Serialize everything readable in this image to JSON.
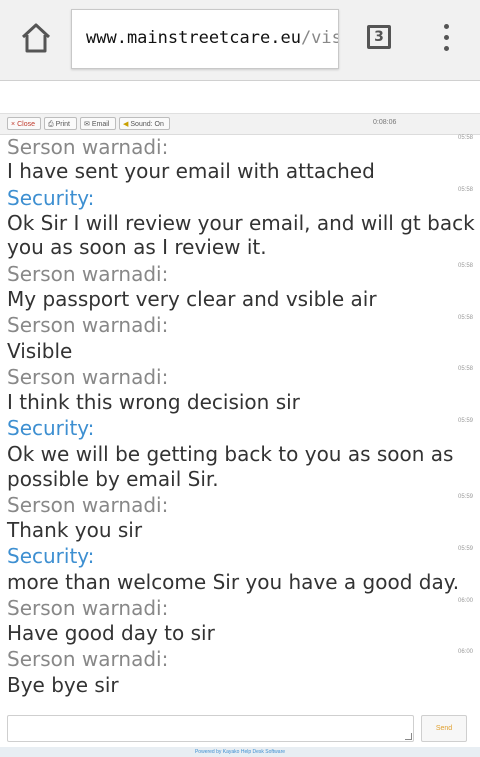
{
  "browser": {
    "url_host": "www.mainstreetcare.eu",
    "url_path": "/visi",
    "tab_count": "3"
  },
  "toolbar": {
    "close_label": "Close",
    "print_label": "Print",
    "email_label": "Email",
    "sound_label": "Sound: On",
    "timer": "0:08:06"
  },
  "chat": {
    "messages": [
      {
        "sender": "Serson warnadi:",
        "text": "I have sent your email with attached",
        "time": "05:58",
        "role": "visitor"
      },
      {
        "sender": "Security:",
        "text": "Ok Sir I will review your email, and will gt back to",
        "text2": "you as soon as I review it.",
        "time": "05:58",
        "role": "staff"
      },
      {
        "sender": "Serson warnadi:",
        "text": "My passport very clear and vsible air",
        "time": "05:58",
        "role": "visitor"
      },
      {
        "sender": "Serson warnadi:",
        "text": "Visible",
        "time": "05:58",
        "role": "visitor"
      },
      {
        "sender": "Serson warnadi:",
        "text": "I think this wrong decision sir",
        "time": "05:59",
        "role": "visitor"
      },
      {
        "sender": "Security:",
        "text": "Ok we will be getting back to you as soon as",
        "text2": "possible by email Sir.",
        "time": "05:59",
        "role": "staff"
      },
      {
        "sender": "Serson warnadi:",
        "text": "Thank you sir",
        "time": "05:59",
        "role": "visitor"
      },
      {
        "sender": "Security:",
        "text": "more than welcome Sir you have a good day.",
        "time": "06:00",
        "role": "staff"
      },
      {
        "sender": "Serson warnadi:",
        "text": "Have good day to sir",
        "time": "06:00",
        "role": "visitor"
      },
      {
        "sender": "Serson warnadi:",
        "text": "Bye bye sir",
        "time": "06:00",
        "role": "visitor"
      }
    ],
    "top_timestamp": "05:58"
  },
  "composer": {
    "send_label": "Send"
  },
  "footer": {
    "text": "Powered by Kayako Help Desk Software"
  },
  "icons": [
    "home-icon",
    "tabs-icon",
    "overflow-menu-icon",
    "close-icon",
    "printer-icon",
    "envelope-icon",
    "speaker-icon"
  ],
  "colors": {
    "staff_name": "#3d8fd1",
    "visitor_name": "#888888",
    "message_text": "#333333",
    "send_button_text": "#e0a030"
  }
}
